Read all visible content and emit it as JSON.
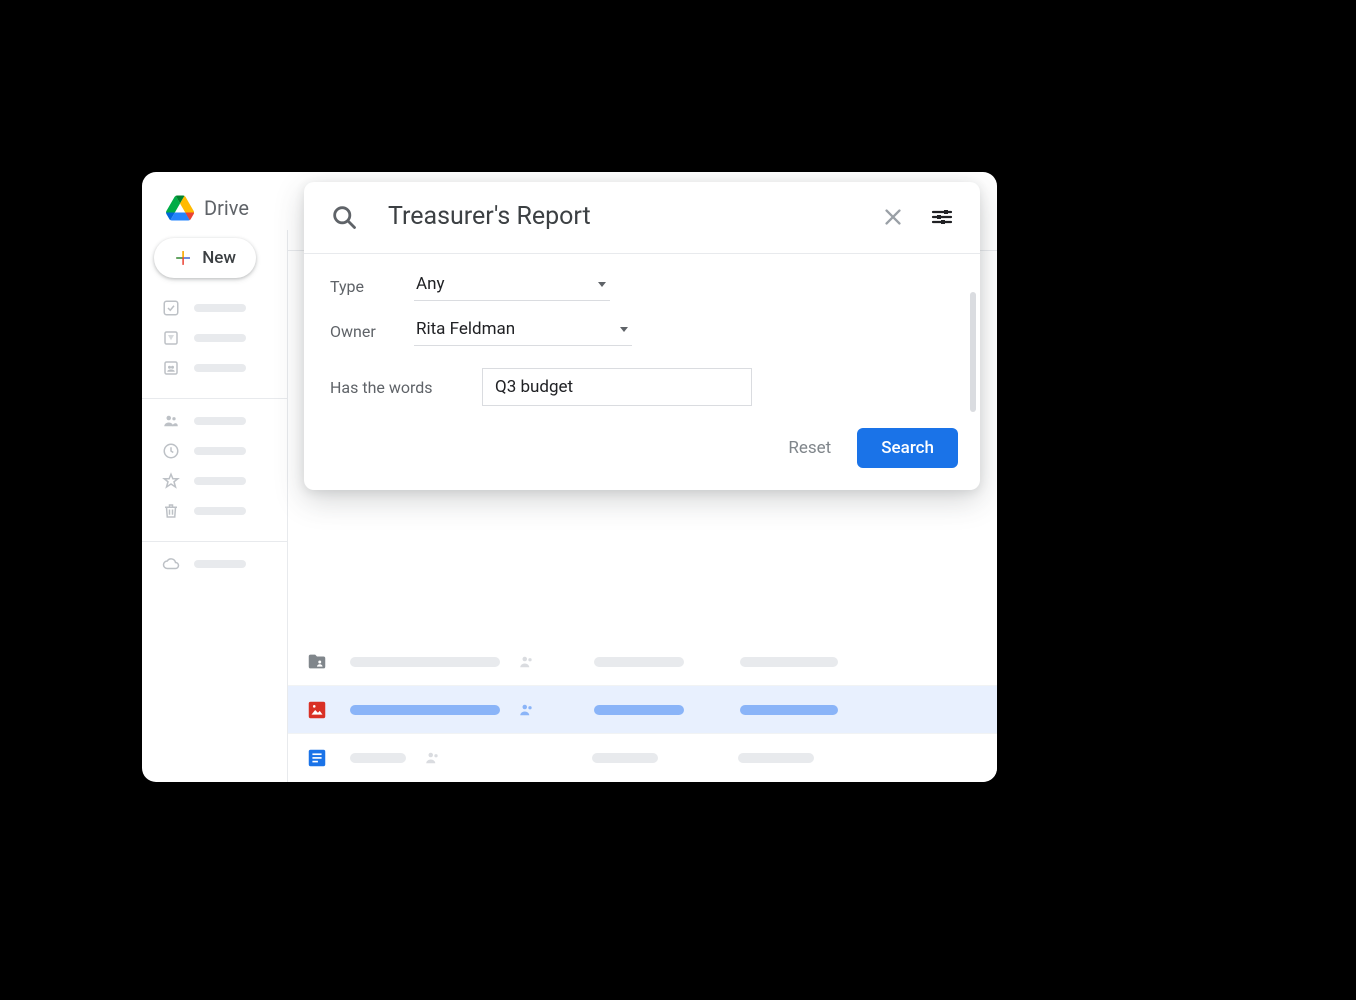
{
  "app": {
    "title": "Drive",
    "new_button": "New"
  },
  "search": {
    "query": "Treasurer's Report",
    "filters": {
      "type_label": "Type",
      "type_value": "Any",
      "owner_label": "Owner",
      "owner_value": "Rita Feldman",
      "words_label": "Has the words",
      "words_value": "Q3 budget"
    },
    "reset_label": "Reset",
    "search_label": "Search"
  },
  "sidebar": {
    "icons_group1": [
      "check-square",
      "drive",
      "shared"
    ],
    "icons_group2": [
      "people",
      "recent",
      "star",
      "trash"
    ],
    "icons_group3": [
      "cloud"
    ]
  },
  "files": [
    {
      "type": "folder-shared",
      "color": "#80868b",
      "selected": false
    },
    {
      "type": "image",
      "color": "#d93025",
      "selected": true
    },
    {
      "type": "docs",
      "color": "#1a73e8",
      "selected": false
    }
  ]
}
